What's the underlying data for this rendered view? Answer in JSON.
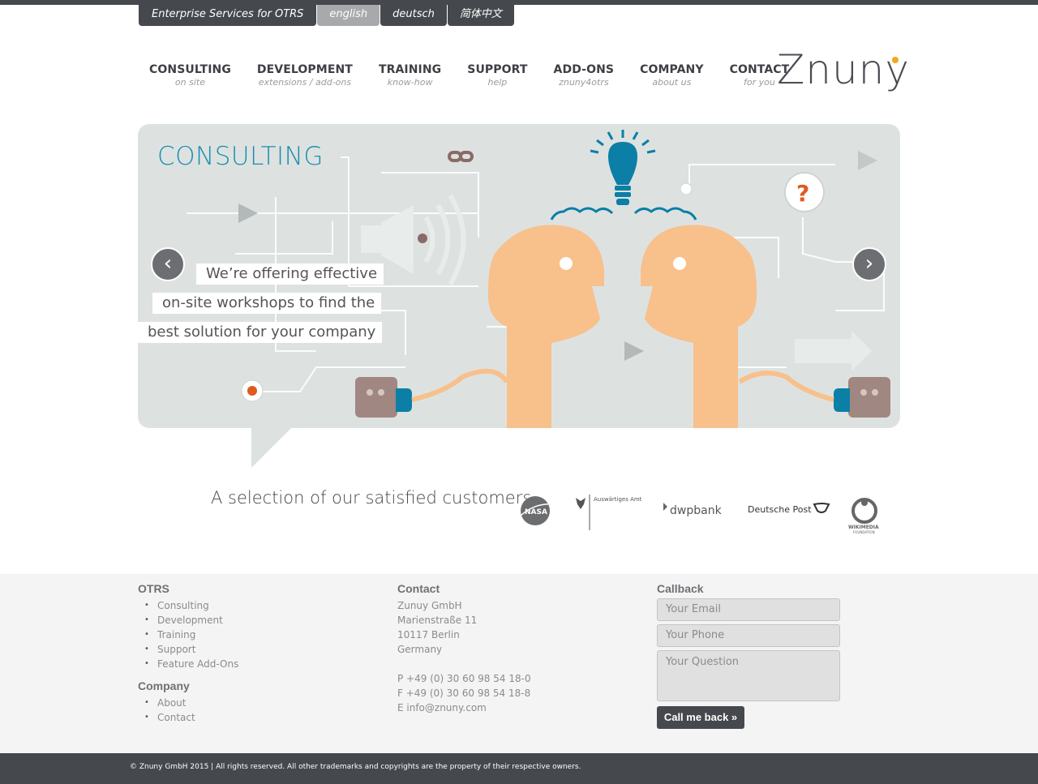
{
  "lang_tabs": {
    "brand": "Enterprise Services for OTRS",
    "english": "english",
    "deutsch": "deutsch",
    "chinese": "简体中文"
  },
  "nav": [
    {
      "title": "CONSULTING",
      "sub": "on site"
    },
    {
      "title": "DEVELOPMENT",
      "sub": "extensions / add-ons"
    },
    {
      "title": "TRAINING",
      "sub": "know-how"
    },
    {
      "title": "SUPPORT",
      "sub": "help"
    },
    {
      "title": "ADD-ONS",
      "sub": "znuny4otrs"
    },
    {
      "title": "COMPANY",
      "sub": "about us"
    },
    {
      "title": "CONTACT",
      "sub": "for you"
    }
  ],
  "logo": {
    "text": "Znuny",
    "dot_color": "#f2a81d"
  },
  "slider": {
    "heading": "CONSULTING",
    "caption_lines": [
      "We’re offering effective",
      "on-site workshops to find the",
      "best solution for your company"
    ],
    "prev_glyph": "‹",
    "next_glyph": "›"
  },
  "customers": {
    "title": "A selection of our satisfied customers",
    "logos": [
      {
        "name": "NASA"
      },
      {
        "name": "Auswärtiges Amt"
      },
      {
        "name": "dwpbank"
      },
      {
        "name": "Deutsche Post"
      },
      {
        "name": "WIKIMEDIA",
        "sub": "FOUNDATION"
      }
    ]
  },
  "footer": {
    "otrs_heading": "OTRS",
    "otrs_links": [
      "Consulting",
      "Development",
      "Training",
      "Support",
      "Feature Add-Ons"
    ],
    "company_heading": "Company",
    "company_links": [
      "About",
      "Contact"
    ],
    "contact_heading": "Contact",
    "address": [
      "Zunuy GmbH",
      "Marienstraße 11",
      "10117 Berlin",
      "Germany"
    ],
    "phone": "P +49 (0) 30 60 98 54 18-0",
    "fax": "F +49 (0) 30 60 98 54 18-8",
    "email": "E info@znuny.com",
    "callback_heading": "Callback",
    "email_placeholder": "Your Email",
    "phone_placeholder": "Your Phone",
    "question_placeholder": "Your Question",
    "button": "Call me back »"
  },
  "copyright": "© Znuny GmbH 2015 | All rights reserved. All other trademarks and copyrights are the property of their respective owners.",
  "colors": {
    "dark": "#45484d",
    "accent": "#1a8fb0",
    "skin": "#f8c08b"
  }
}
